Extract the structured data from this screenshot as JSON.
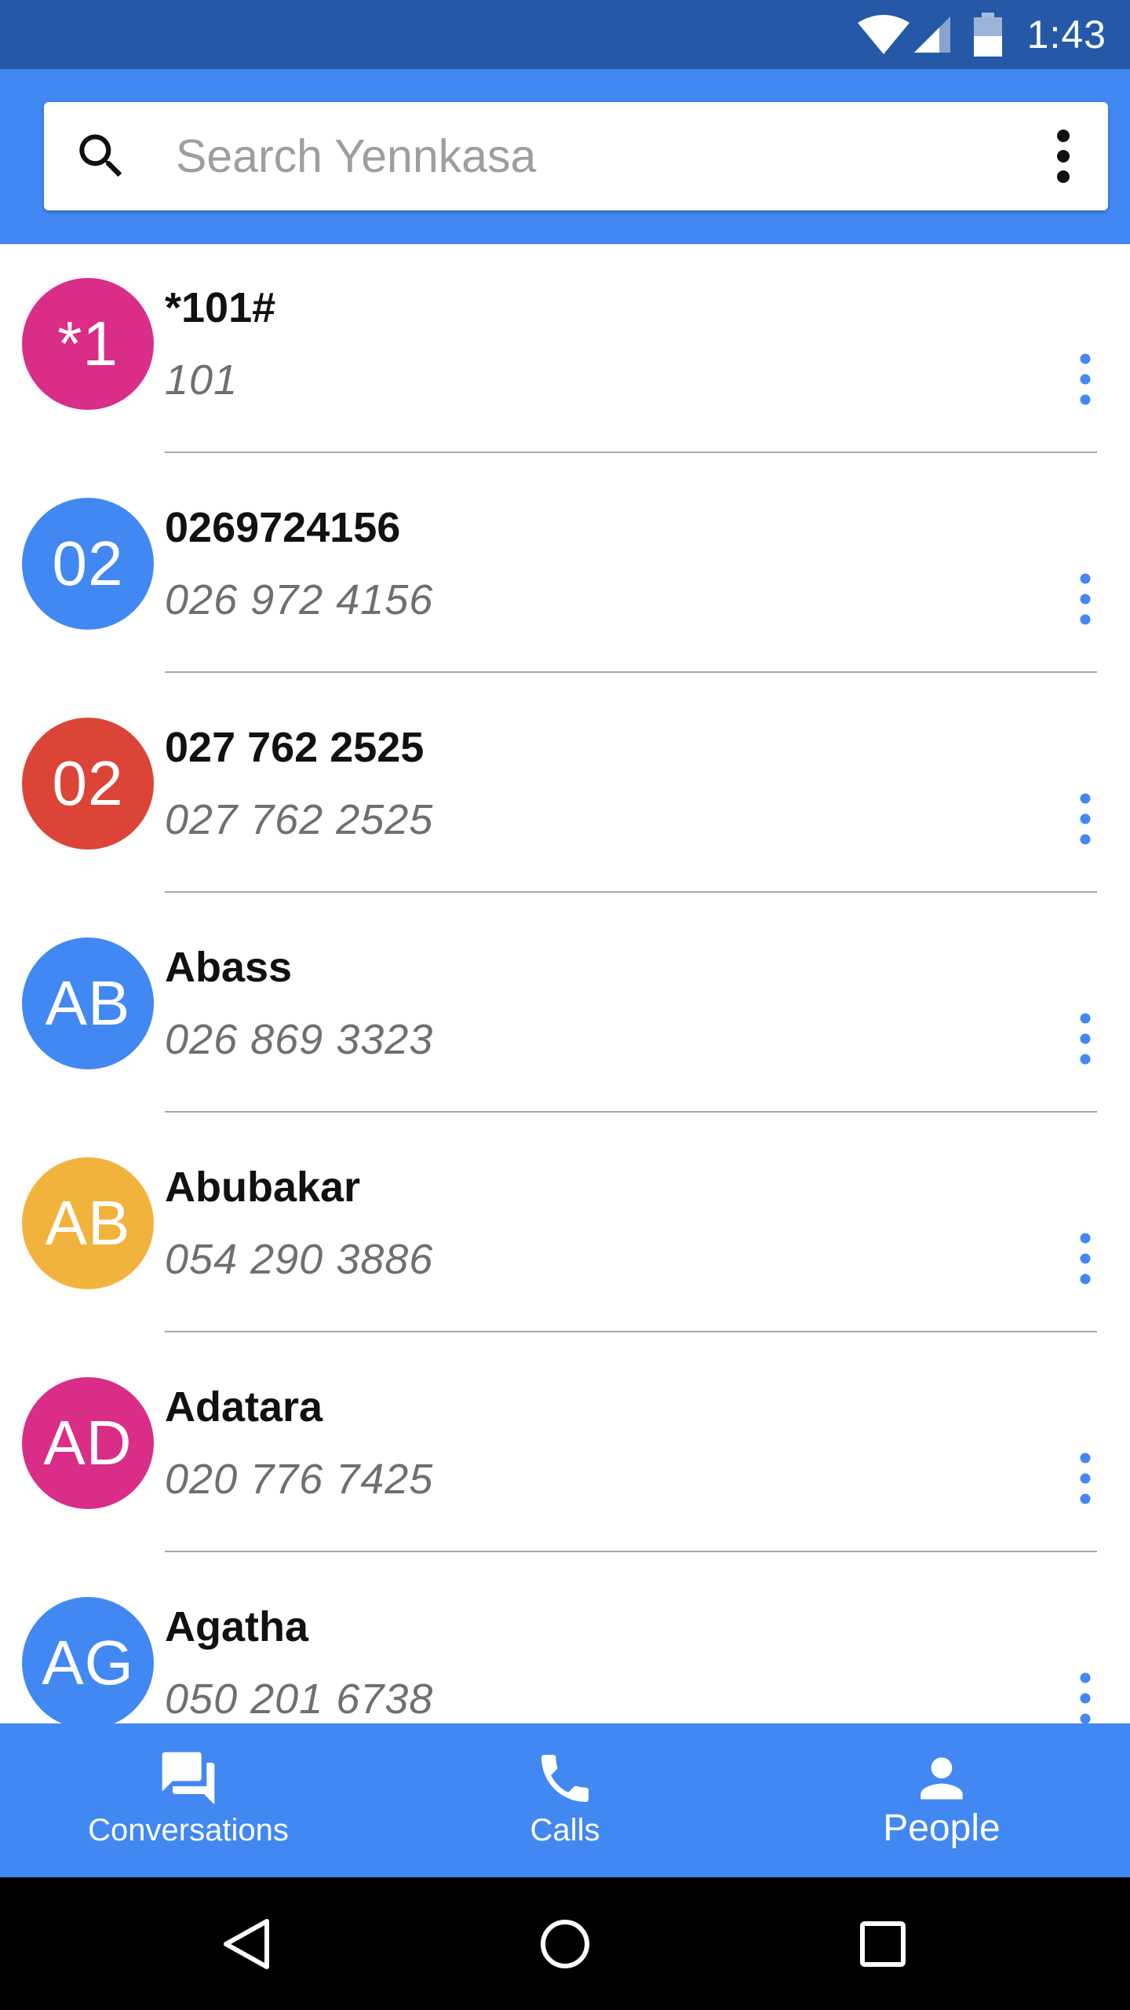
{
  "status_bar": {
    "time": "1:43",
    "icons": [
      "wifi-icon",
      "cell-signal-icon",
      "battery-icon"
    ],
    "background": "#2559a8"
  },
  "app_bar": {
    "background": "#4188f3",
    "search": {
      "placeholder": "Search Yennkasa",
      "value": ""
    },
    "icons": [
      "search-icon",
      "overflow-menu-icon"
    ]
  },
  "contacts": [
    {
      "initials": "*1",
      "name": "*101#",
      "number": "101",
      "color": "#d92d88"
    },
    {
      "initials": "02",
      "name": "0269724156",
      "number": "026 972 4156",
      "color": "#4188f3"
    },
    {
      "initials": "02",
      "name": "027 762 2525",
      "number": "027 762 2525",
      "color": "#dc4437"
    },
    {
      "initials": "AB",
      "name": "Abass",
      "number": "026 869 3323",
      "color": "#4188f3"
    },
    {
      "initials": "AB",
      "name": "Abubakar",
      "number": "054 290 3886",
      "color": "#f2b33d"
    },
    {
      "initials": "AD",
      "name": "Adatara",
      "number": "020 776 7425",
      "color": "#d92d88"
    },
    {
      "initials": "AG",
      "name": "Agatha",
      "number": "050 201 6738",
      "color": "#4188f3"
    }
  ],
  "menu_dot_color": "#4188f3",
  "bottom_nav": {
    "background": "#4188f3",
    "tabs": [
      {
        "label": "Conversations",
        "icon": "chat-icon",
        "active": false
      },
      {
        "label": "Calls",
        "icon": "phone-icon",
        "active": false
      },
      {
        "label": "People",
        "icon": "person-icon",
        "active": true
      }
    ]
  },
  "system_nav": {
    "icons": [
      "back-icon",
      "home-icon",
      "recents-icon"
    ]
  }
}
